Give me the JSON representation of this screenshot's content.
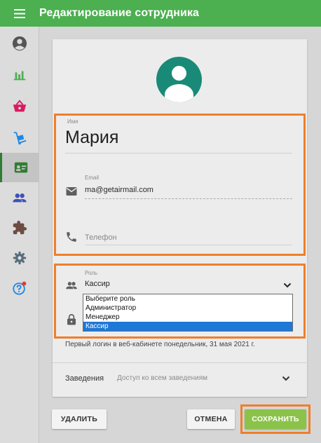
{
  "appbar": {
    "title": "Редактирование сотрудника",
    "menu_icon": "hamburger-menu-icon"
  },
  "sidebar": {
    "items": [
      {
        "icon": "account-circle-icon",
        "color": "#555555"
      },
      {
        "icon": "bar-chart-icon",
        "color": "#4caf50"
      },
      {
        "icon": "shopping-basket-icon",
        "color": "#d81b60"
      },
      {
        "icon": "dolly-cart-icon",
        "color": "#1e88e5"
      },
      {
        "icon": "badge-card-icon",
        "color": "#2e7d32",
        "active": true
      },
      {
        "icon": "people-icon",
        "color": "#3f51b5"
      },
      {
        "icon": "puzzle-icon",
        "color": "#6d4c41"
      },
      {
        "icon": "gear-icon",
        "color": "#546e7a"
      },
      {
        "icon": "help-icon",
        "color": "#1e88e5",
        "badge": true
      }
    ]
  },
  "form": {
    "name_label": "Имя",
    "name_value": "Мария",
    "email_label": "Email",
    "email_value": "ma@getairmail.com",
    "phone_placeholder": "Телефон",
    "role_label": "Роль",
    "role_value": "Кассир",
    "role_options": [
      "Выберите роль",
      "Администратор",
      "Менеджер",
      "Кассир"
    ],
    "role_selected_index": 3,
    "info_text": "Первый логин в веб-кабинете понедельник, 31 мая 2021 г.",
    "branches_label": "Заведения",
    "branches_value": "Доступ ко всем заведениям"
  },
  "buttons": {
    "delete": "УДАЛИТЬ",
    "cancel": "ОТМЕНА",
    "save": "СОХРАНИТЬ"
  },
  "colors": {
    "appbar": "#4caf50",
    "avatar": "#1a8a78",
    "save": "#8bc34a",
    "highlight": "#ef7f2b",
    "selected_option": "#1e78d7"
  }
}
